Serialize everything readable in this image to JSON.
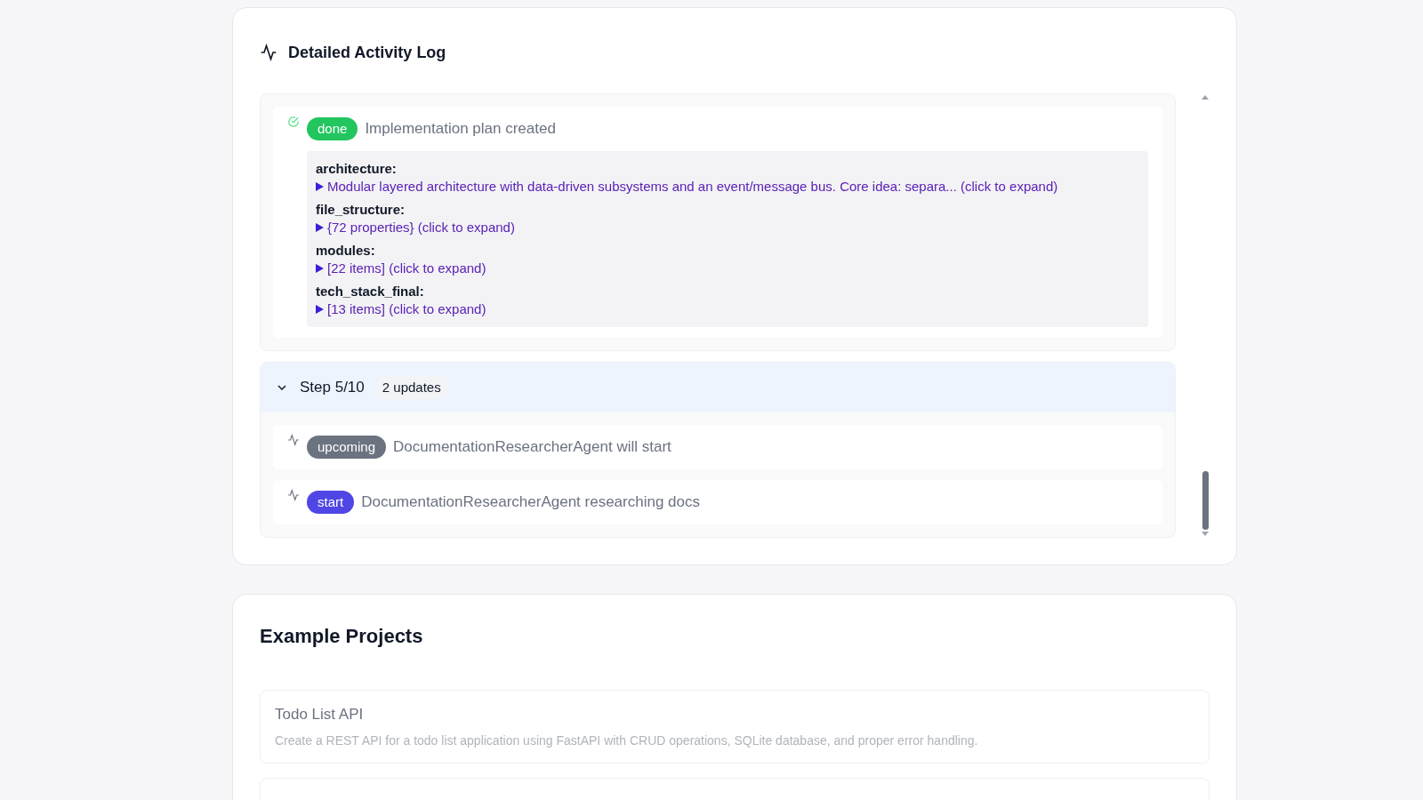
{
  "activity_log": {
    "title": "Detailed Activity Log",
    "groups": [
      {
        "entries": [
          {
            "kind": "done",
            "badge": "done",
            "message": "Implementation plan created",
            "details": [
              {
                "key": "architecture:",
                "value": "Modular layered architecture with data-driven subsystems and an event/message bus. Core idea: separa... (click to expand)"
              },
              {
                "key": "file_structure:",
                "value": "{72 properties} (click to expand)"
              },
              {
                "key": "modules:",
                "value": "[22 items] (click to expand)"
              },
              {
                "key": "tech_stack_final:",
                "value": "[13 items] (click to expand)"
              }
            ]
          }
        ]
      },
      {
        "header": {
          "label": "Step 5/10",
          "count": "2 updates",
          "expanded": true
        },
        "entries": [
          {
            "kind": "upcoming",
            "badge": "upcoming",
            "message": "DocumentationResearcherAgent will start"
          },
          {
            "kind": "start",
            "badge": "start",
            "message": "DocumentationResearcherAgent researching docs"
          }
        ]
      }
    ]
  },
  "example_projects": {
    "title": "Example Projects",
    "items": [
      {
        "name": "Todo List API",
        "description": "Create a REST API for a todo list application using FastAPI with CRUD operations, SQLite database, and proper error handling."
      }
    ],
    "next_card_cut_off": true
  }
}
